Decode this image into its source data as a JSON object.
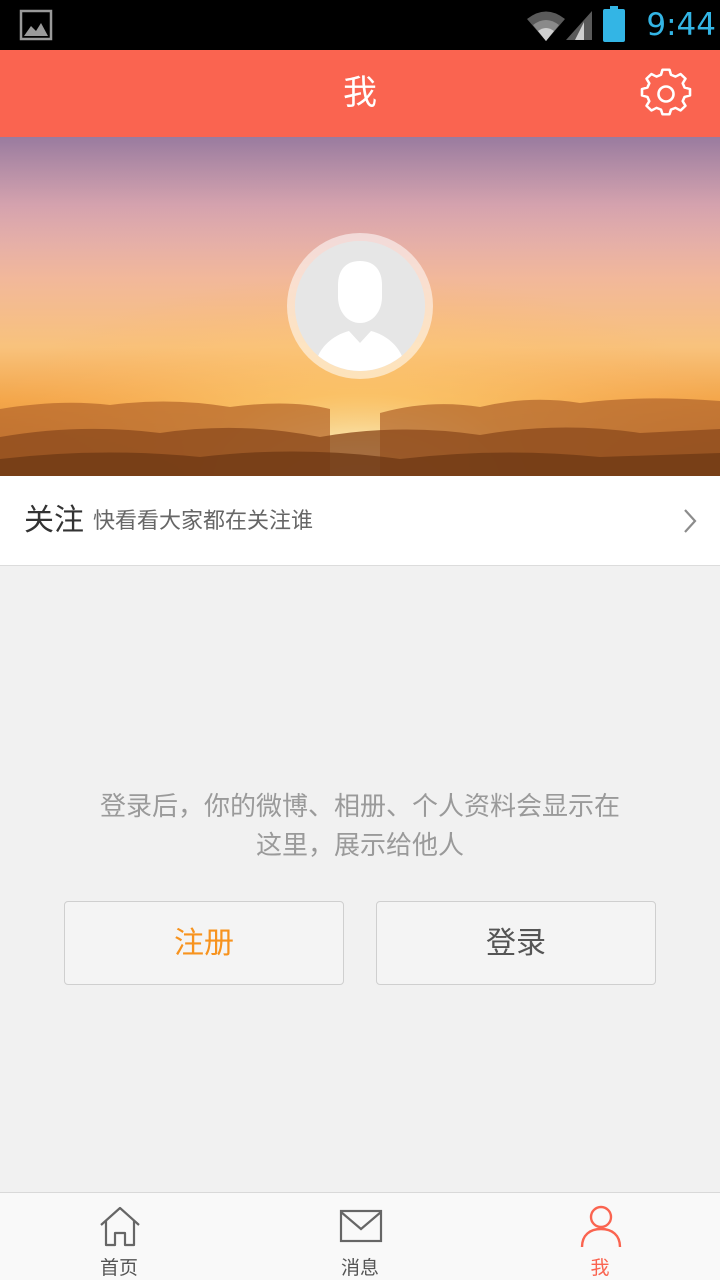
{
  "status_bar": {
    "time": "9:44",
    "icons": [
      "picture-icon",
      "wifi-icon",
      "signal-icon",
      "battery-icon"
    ]
  },
  "header": {
    "title": "我",
    "settings_icon": "gear-icon"
  },
  "profile": {
    "avatar_icon": "default-avatar-icon"
  },
  "follow": {
    "title": "关注",
    "subtitle": "快看看大家都在关注谁"
  },
  "prompt": {
    "line1": "登录后，你的微博、相册、个人资料会显示在",
    "line2": "这里，展示给他人"
  },
  "buttons": {
    "register": "注册",
    "login": "登录"
  },
  "tabs": [
    {
      "label": "首页",
      "icon": "home-icon"
    },
    {
      "label": "消息",
      "icon": "envelope-icon"
    },
    {
      "label": "我",
      "icon": "person-icon",
      "active": true
    }
  ],
  "colors": {
    "accent": "#fa6450",
    "register_text": "#f7931e",
    "status_time": "#33b5e5"
  }
}
